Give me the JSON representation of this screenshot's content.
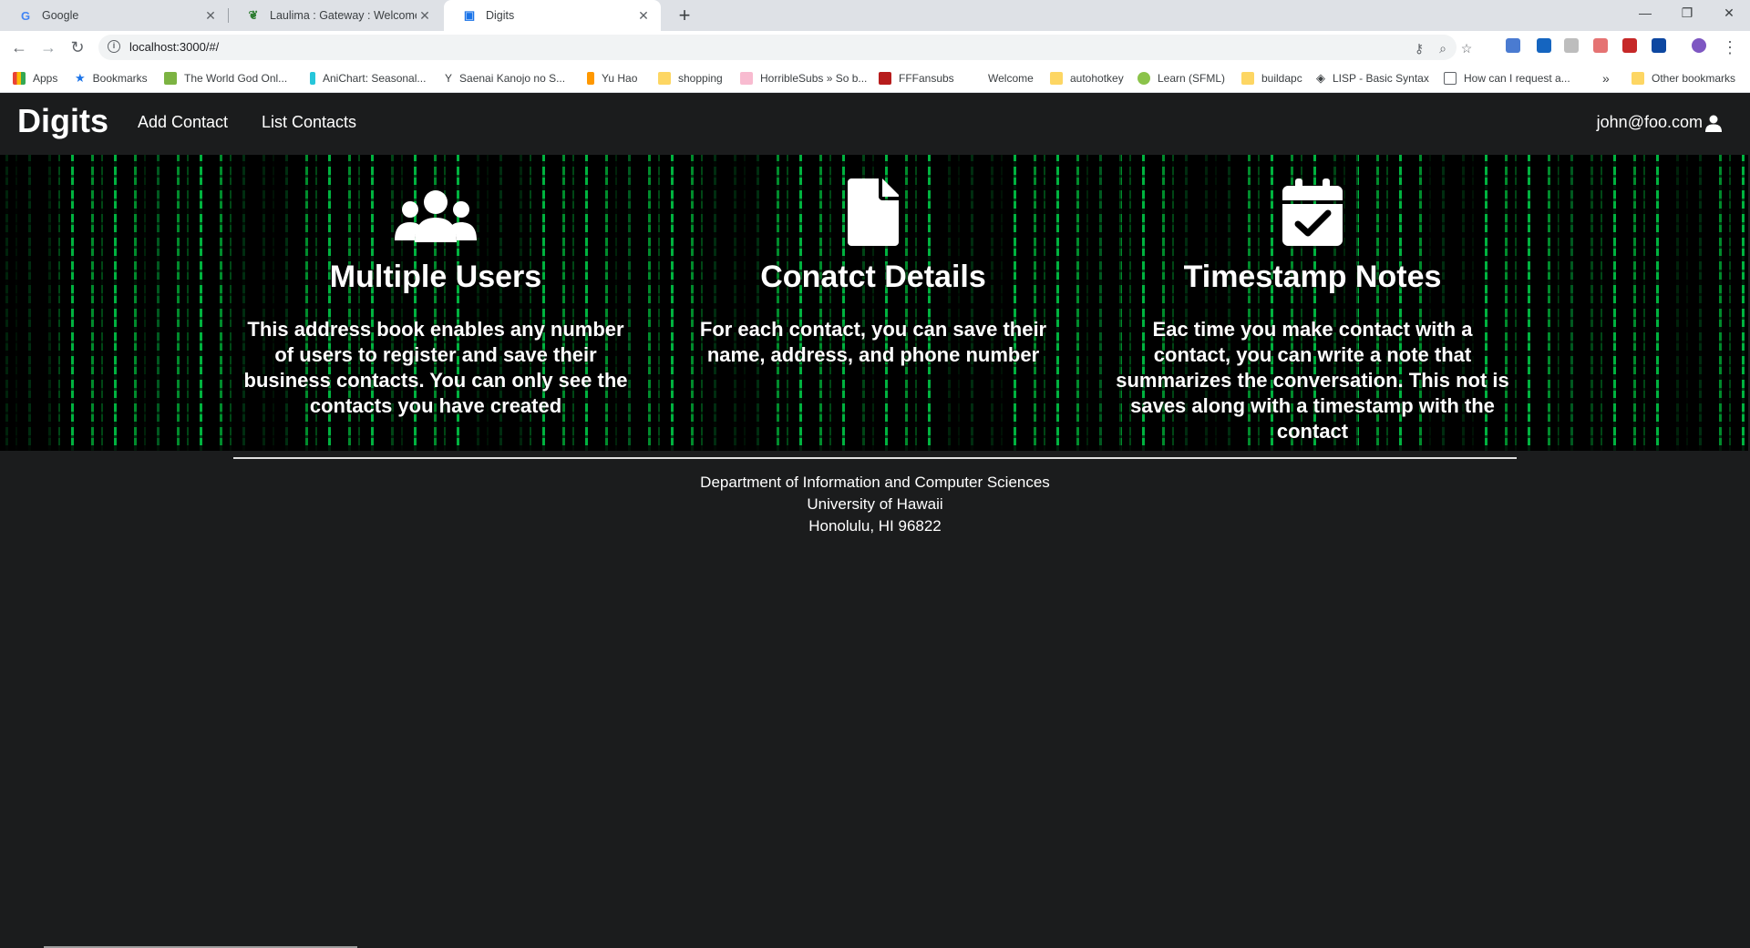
{
  "browser": {
    "tabs": [
      {
        "title": "Google",
        "active": false
      },
      {
        "title": "Laulima : Gateway : Welcome",
        "active": false
      },
      {
        "title": "Digits",
        "active": true
      }
    ],
    "url": "localhost:3000/#/",
    "bookmarks": [
      {
        "label": "Apps",
        "icon": "apps-grid-icon"
      },
      {
        "label": "Bookmarks",
        "icon": "star-icon"
      },
      {
        "label": "The World God Onl...",
        "icon": "site-icon"
      },
      {
        "label": "AniChart: Seasonal...",
        "icon": "site-icon"
      },
      {
        "label": "Saenai Kanojo no S...",
        "icon": "site-icon"
      },
      {
        "label": "Yu Hao",
        "icon": "site-icon"
      },
      {
        "label": "shopping",
        "icon": "folder-icon"
      },
      {
        "label": "HorribleSubs » So b...",
        "icon": "site-icon"
      },
      {
        "label": "FFFansubs",
        "icon": "site-icon"
      },
      {
        "label": "Welcome",
        "icon": "blank-icon"
      },
      {
        "label": "autohotkey",
        "icon": "folder-icon"
      },
      {
        "label": "Learn (SFML)",
        "icon": "site-icon"
      },
      {
        "label": "buildapc",
        "icon": "folder-icon"
      },
      {
        "label": "LISP - Basic Syntax",
        "icon": "site-icon"
      },
      {
        "label": "How can I request a...",
        "icon": "page-icon"
      }
    ],
    "bookmarks_overflow": "»",
    "other_bookmarks": "Other bookmarks"
  },
  "navbar": {
    "brand": "Digits",
    "links": [
      "Add Contact",
      "List Contacts"
    ],
    "user": "john@foo.com"
  },
  "features": [
    {
      "icon": "users-icon",
      "title": "Multiple Users",
      "text": "This address book enables any number of users to register and save their business contacts. You can only see the contacts you have created"
    },
    {
      "icon": "file-icon",
      "title": "Conatct Details",
      "text": "For each contact, you can save their name, address, and phone number"
    },
    {
      "icon": "calendar-check-icon",
      "title": "Timestamp Notes",
      "text": "Eac time you make contact with a contact, you can write a note that summarizes the conversation. This not is saves along with a timestamp with the contact"
    }
  ],
  "footer": {
    "line1": "Department of Information and Computer Sciences",
    "line2": "University of Hawaii",
    "line3": "Honolulu, HI 96822"
  },
  "colors": {
    "navbar_bg": "#1b1c1d",
    "matrix_green": "#00ff50",
    "text": "#ffffff"
  }
}
